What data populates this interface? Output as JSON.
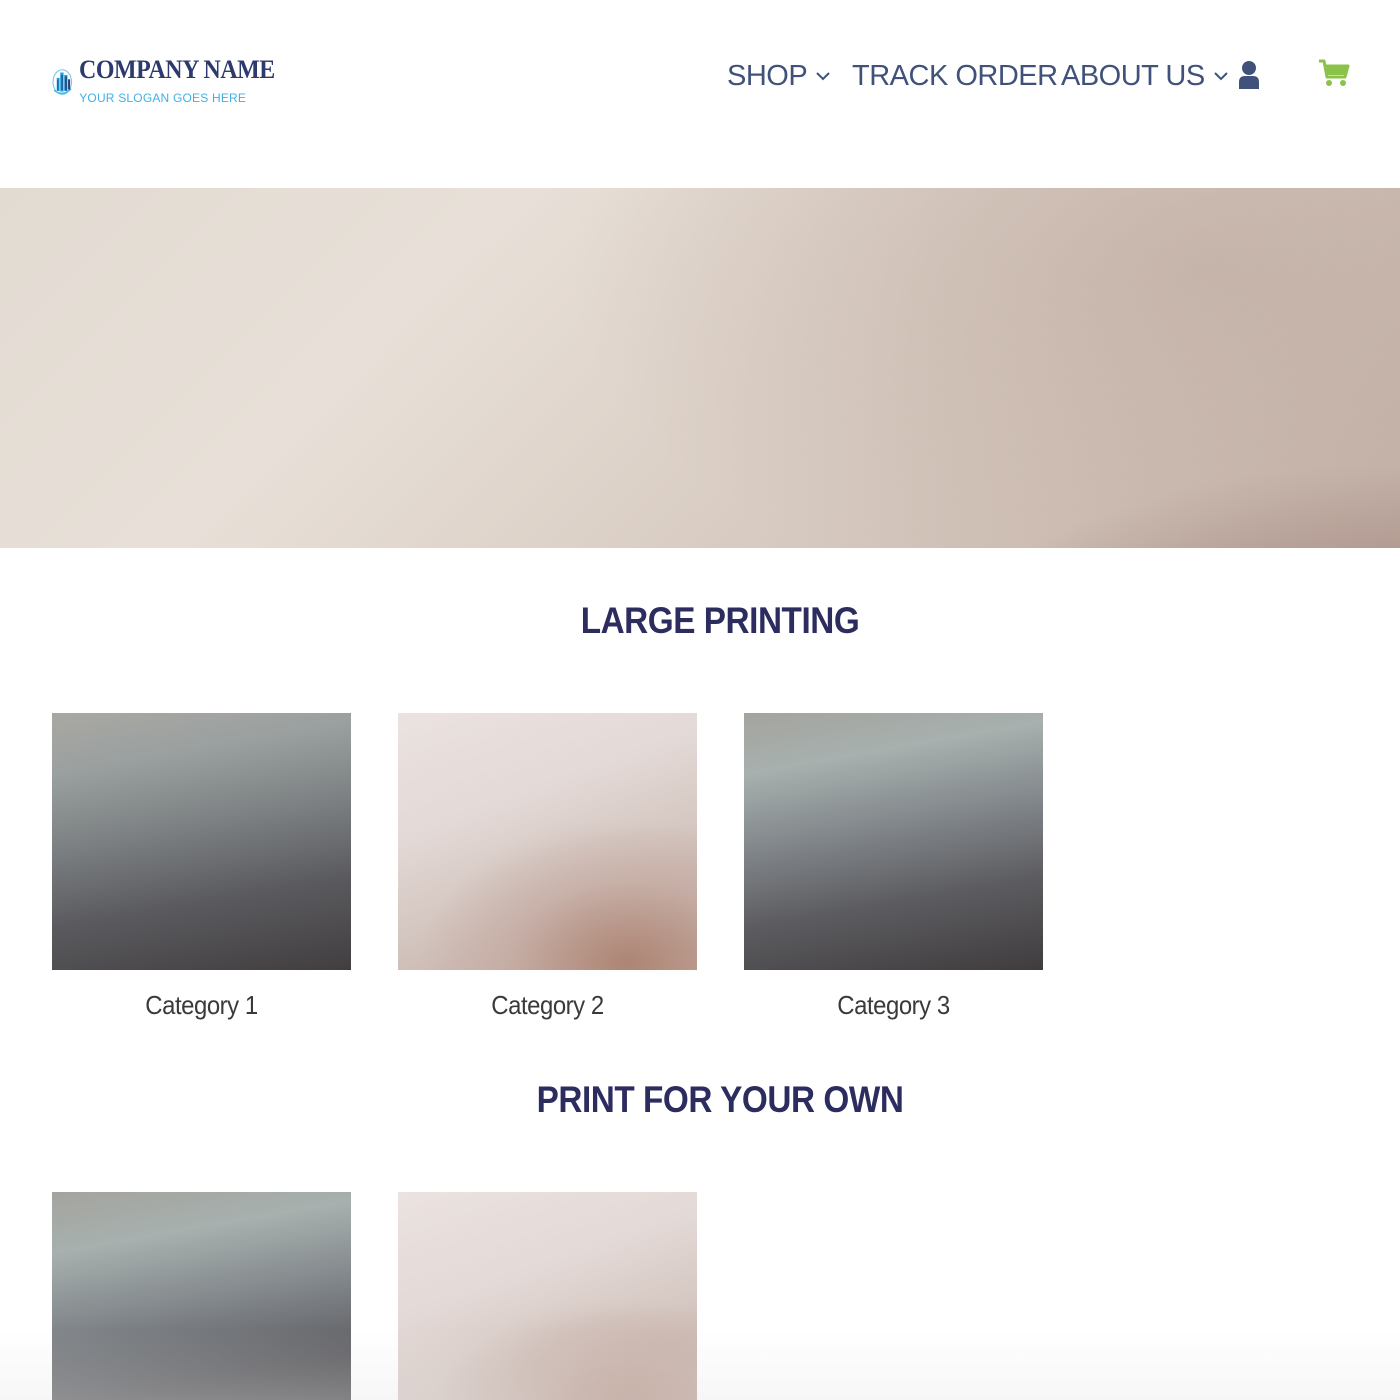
{
  "brand": {
    "company_name": "COMPANY NAME",
    "slogan": "YOUR SLOGAN GOES HERE",
    "colors": {
      "navy": "#2d3a6e",
      "cyan": "#3fb1e6",
      "nav_text": "#41527a",
      "cart_green": "#8bc34a",
      "section_title": "#2c2d5e"
    }
  },
  "nav": {
    "shop": "SHOP",
    "track_order": "TRACK ORDER",
    "about_us": "ABOUT US",
    "icons": {
      "account": "user-icon",
      "cart": "cart-icon",
      "dropdown": "chevron-down-icon"
    }
  },
  "sections": [
    {
      "title": "LARGE PRINTING",
      "cards": [
        {
          "label": "Category 1"
        },
        {
          "label": "Category 2"
        },
        {
          "label": "Category 3"
        }
      ]
    },
    {
      "title": "PRINT FOR YOUR OWN",
      "cards": [
        {
          "label": ""
        },
        {
          "label": ""
        }
      ]
    }
  ]
}
